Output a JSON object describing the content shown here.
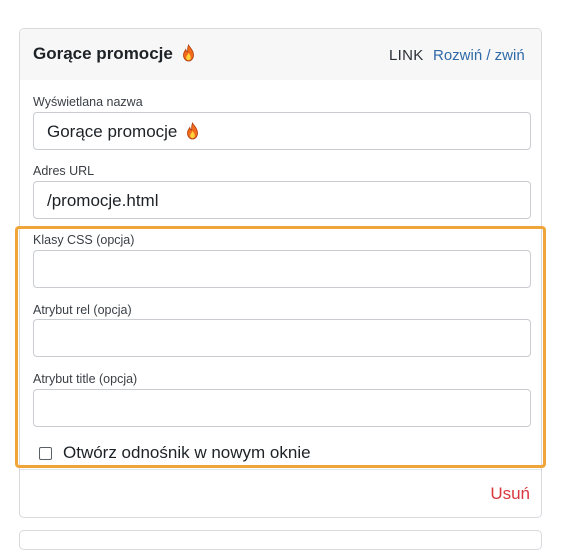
{
  "item": {
    "title": "Gorące promocje",
    "title_icon": "fire-icon",
    "type": "LINK",
    "toggle_label": "Rozwiń / zwiń"
  },
  "fields": {
    "display_name": {
      "label": "Wyświetlana nazwa",
      "value": "Gorące promocje",
      "value_icon": "fire-icon"
    },
    "url": {
      "label": "Adres URL",
      "value": "/promocje.html"
    },
    "css_classes": {
      "label": "Klasy CSS (opcja)",
      "value": ""
    },
    "rel": {
      "label": "Atrybut rel (opcja)",
      "value": ""
    },
    "title_attr": {
      "label": "Atrybut title (opcja)",
      "value": ""
    },
    "new_window": {
      "label": "Otwórz odnośnik w nowym oknie",
      "checked": false
    }
  },
  "actions": {
    "remove_label": "Usuń"
  },
  "colors": {
    "highlight": "#f0a53a",
    "link": "#2f6aa8",
    "danger": "#d9363e"
  }
}
